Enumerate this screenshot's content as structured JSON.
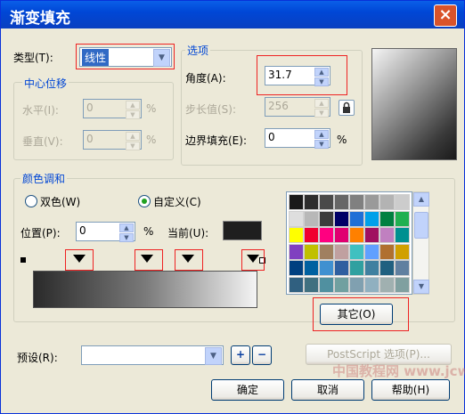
{
  "window": {
    "title": "渐变填充",
    "close_glyph": "×"
  },
  "type": {
    "label": "类型(T):",
    "value": "线性"
  },
  "center": {
    "legend": "中心位移",
    "h_label": "水平(I):",
    "h_value": "0",
    "v_label": "垂直(V):",
    "v_value": "0",
    "unit": "%"
  },
  "options": {
    "legend": "选项",
    "angle_label": "角度(A):",
    "angle_value": "31.7",
    "steps_label": "步长值(S):",
    "steps_value": "256",
    "edge_label": "边界填充(E):",
    "edge_value": "0",
    "edge_unit": "%",
    "lock_icon": "lock-icon"
  },
  "blend": {
    "legend": "颜色调和",
    "two_color": "双色(W)",
    "custom": "自定义(C)",
    "selected": "custom",
    "position_label": "位置(P):",
    "position_value": "0",
    "position_unit": "%",
    "current_label": "当前(U):",
    "current_color": "#1f1f1f",
    "gradient_start": "#2a2a2a",
    "gradient_end": "#f4f4f4"
  },
  "palette": {
    "colors": [
      [
        "#1a1a1a",
        "#2e2e2e",
        "#4a4a4a",
        "#666666",
        "#808080",
        "#9a9a9a",
        "#b3b3b3",
        "#cccccc"
      ],
      [
        "#dedede",
        "#b8b8b8",
        "#3c3c3c",
        "#000066",
        "#1f6fd6",
        "#00a0e9",
        "#008040",
        "#20b050"
      ],
      [
        "#ffff00",
        "#f00030",
        "#ff0080",
        "#e00070",
        "#ff8000",
        "#a01060",
        "#c080c0",
        "#009090"
      ],
      [
        "#8040c0",
        "#c0c000",
        "#a08060",
        "#c0a0a0",
        "#40c0c0",
        "#60a0ff",
        "#b07030",
        "#d0a000"
      ],
      [
        "#004080",
        "#0060a0",
        "#4090d0",
        "#2f5fa0",
        "#30a0a0",
        "#4080a0",
        "#206080",
        "#6080a0"
      ],
      [
        "#306080",
        "#407080",
        "#5090a0",
        "#70a0a0",
        "#80a0b0",
        "#90b0c0",
        "#a0b0b0",
        "#80a0a0"
      ]
    ],
    "other_button": "其它(O)"
  },
  "preset": {
    "label": "预设(R):",
    "value": "",
    "add": "+",
    "remove": "−",
    "postscript_button": "PostScript 选项(P)..."
  },
  "footer": {
    "ok": "确定",
    "cancel": "取消",
    "help": "帮助(H)"
  },
  "watermark": "中国教程网 www.jcwcn.com"
}
